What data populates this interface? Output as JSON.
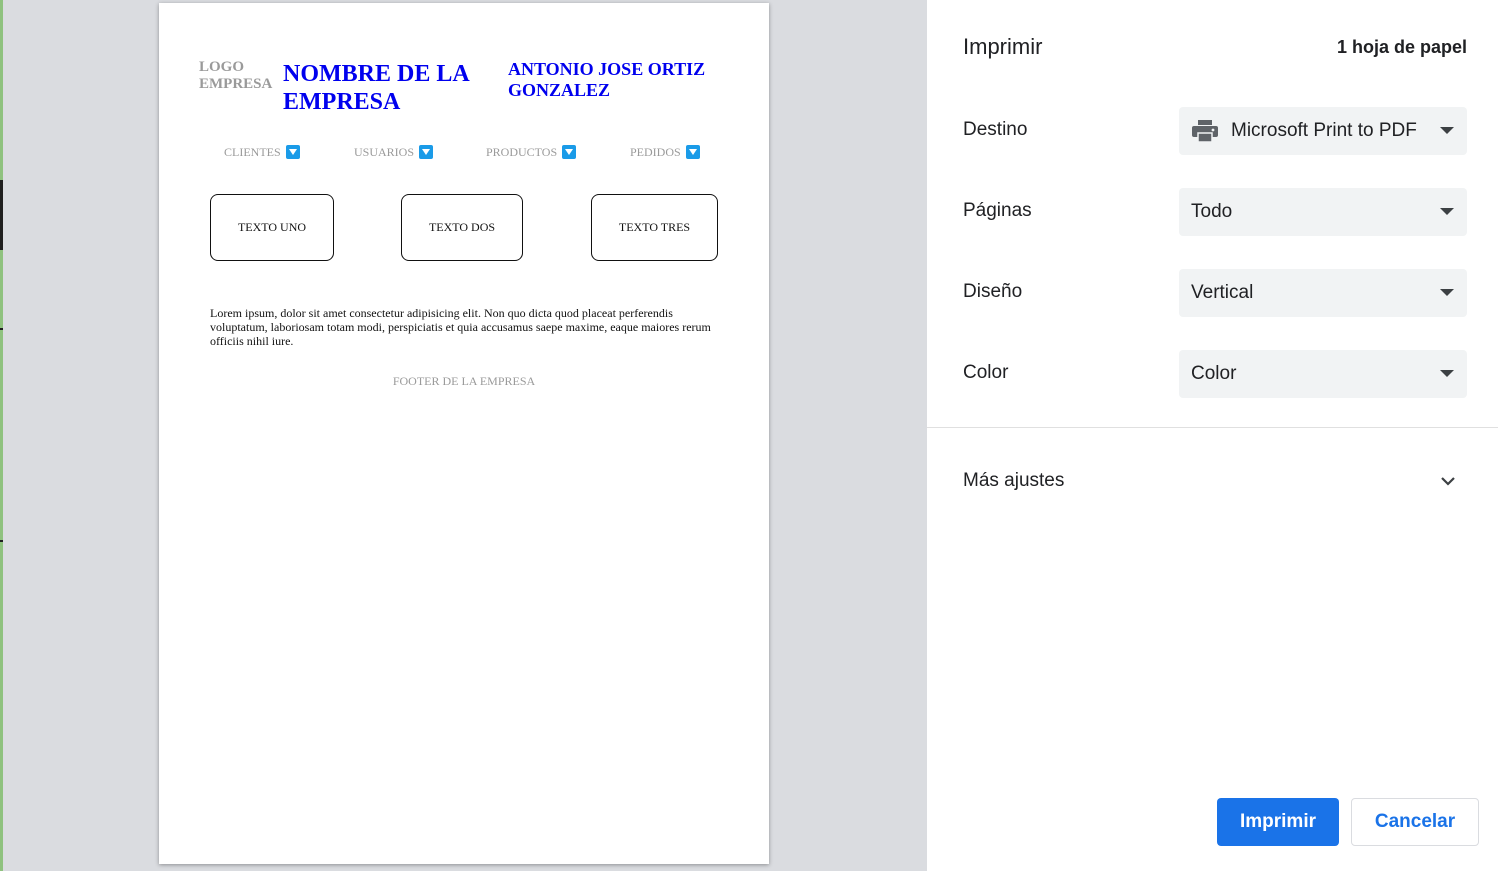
{
  "preview": {
    "document": {
      "logo": "LOGO EMPRESA",
      "company_name": "NOMBRE DE LA EMPRESA",
      "author": "ANTONIO JOSE ORTIZ GONZALEZ",
      "nav": [
        {
          "label": "CLIENTES"
        },
        {
          "label": "USUARIOS"
        },
        {
          "label": "PRODUCTOS"
        },
        {
          "label": "PEDIDOS"
        }
      ],
      "boxes": [
        {
          "label": "TEXTO UNO"
        },
        {
          "label": "TEXTO DOS"
        },
        {
          "label": "TEXTO TRES"
        }
      ],
      "paragraph": "Lorem ipsum, dolor sit amet consectetur adipisicing elit. Non quo dicta quod placeat perferendis voluptatum, laboriosam totam modi, perspiciatis et quia accusamus saepe maxime, eaque maiores rerum officiis nihil iure.",
      "footer": "FOOTER DE LA EMPRESA"
    }
  },
  "settings": {
    "title": "Imprimir",
    "sheet_count": "1 hoja de papel",
    "destination": {
      "label": "Destino",
      "value": "Microsoft Print to PDF",
      "icon": "printer-icon"
    },
    "pages": {
      "label": "Páginas",
      "value": "Todo"
    },
    "layout": {
      "label": "Diseño",
      "value": "Vertical"
    },
    "color": {
      "label": "Color",
      "value": "Color"
    },
    "more_settings": {
      "label": "Más ajustes",
      "icon": "chevron-down-icon"
    },
    "print_label": "Imprimir",
    "cancel_label": "Cancelar"
  },
  "colors": {
    "accent": "#1a73e8",
    "document_link": "#0000ee",
    "preview_background": "#dadce0",
    "select_background": "#f1f3f4"
  }
}
